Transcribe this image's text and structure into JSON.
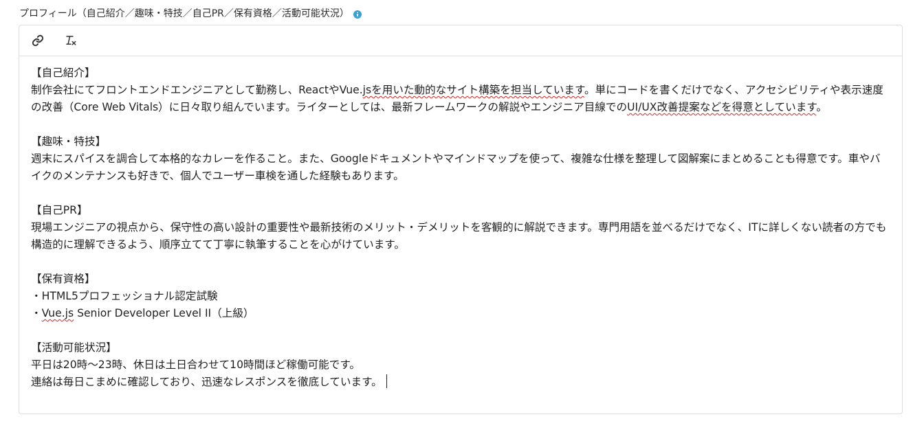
{
  "field": {
    "label": "プロフィール（自己紹介／趣味・特技／自己PR／保有資格／活動可能状況）",
    "info_icon": "info-icon",
    "info_color": "#3aa0d8"
  },
  "toolbar": {
    "link_icon": "link-icon",
    "clear_format_icon": "clear-format-icon"
  },
  "content": {
    "intro_heading": "【自己紹介】",
    "intro_a": "制作会社にてフロントエンドエンジニアとして勤務し、ReactやVue.",
    "intro_b": "jsを用いた動的なサイト構築を担当しています",
    "intro_c": "。単にコードを書くだけでなく、アクセシビリティや表示速度の改善（Core Web Vitals）に日々取り組んでいます。ライターとしては、最新フレームワークの解説やエンジニア目線での",
    "intro_d": "UI/UX改善提案などを得意としています",
    "intro_e": "。",
    "hobby_heading": "【趣味・特技】",
    "hobby_text": "週末にスパイスを調合して本格的なカレーを作ること。また、Googleドキュメントやマインドマップを使って、複雑な仕様を整理して図解案にまとめることも得意です。車やバイクのメンテナンスも好きで、個人でユーザー車検を通した経験もあります。",
    "pr_heading": "【自己PR】",
    "pr_text": "現場エンジニアの視点から、保守性の高い設計の重要性や最新技術のメリット・デメリットを客観的に解説できます。専門用語を並べるだけでなく、ITに詳しくない読者の方でも構造的に理解できるよう、順序立てて丁寧に執筆することを心がけています。",
    "cert_heading": "【保有資格】",
    "cert_1": "・HTML5プロフェッショナル認定試験",
    "cert_2_prefix": "・",
    "cert_2_misspelled": "Vue.js",
    "cert_2_rest": " Senior Developer Level II（上級）",
    "avail_heading": "【活動可能状況】",
    "avail_1": "平日は20時～23時、休日は土日合わせて10時間ほど稼働可能です。",
    "avail_2": "連絡は毎日こまめに確認しており、迅速なレスポンスを徹底しています。"
  },
  "colors": {
    "border": "#dcdcdc",
    "spellcheck": "#e0221b",
    "text": "#1f1f1f"
  }
}
